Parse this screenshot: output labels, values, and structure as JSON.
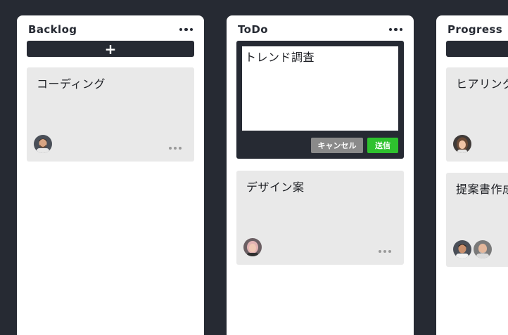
{
  "columns": {
    "backlog": {
      "title": "Backlog",
      "add_label": "+",
      "cards": [
        {
          "title": "コーディング",
          "avatars": [
            "man-beard"
          ]
        }
      ]
    },
    "todo": {
      "title": "ToDo",
      "editor": {
        "value": "トレンド調査",
        "cancel_label": "キャンセル",
        "send_label": "送信"
      },
      "cards": [
        {
          "title": "デザイン案",
          "avatars": [
            "woman-pink-hair"
          ]
        }
      ]
    },
    "progress": {
      "title": "Progress",
      "cards": [
        {
          "title": "ヒアリング",
          "avatars": [
            "woman-smiling"
          ]
        },
        {
          "title": "提案書作成",
          "avatars": [
            "man-dark-hair",
            "man-bald"
          ]
        }
      ]
    }
  },
  "icons": {
    "column_menu": "more-horizontal-icon",
    "card_menu": "more-horizontal-icon",
    "add": "plus-icon"
  },
  "colors": {
    "background": "#262a33",
    "column": "#ffffff",
    "card": "#e9e9e9",
    "cancel": "#8a8a8a",
    "send": "#2ec22e"
  }
}
